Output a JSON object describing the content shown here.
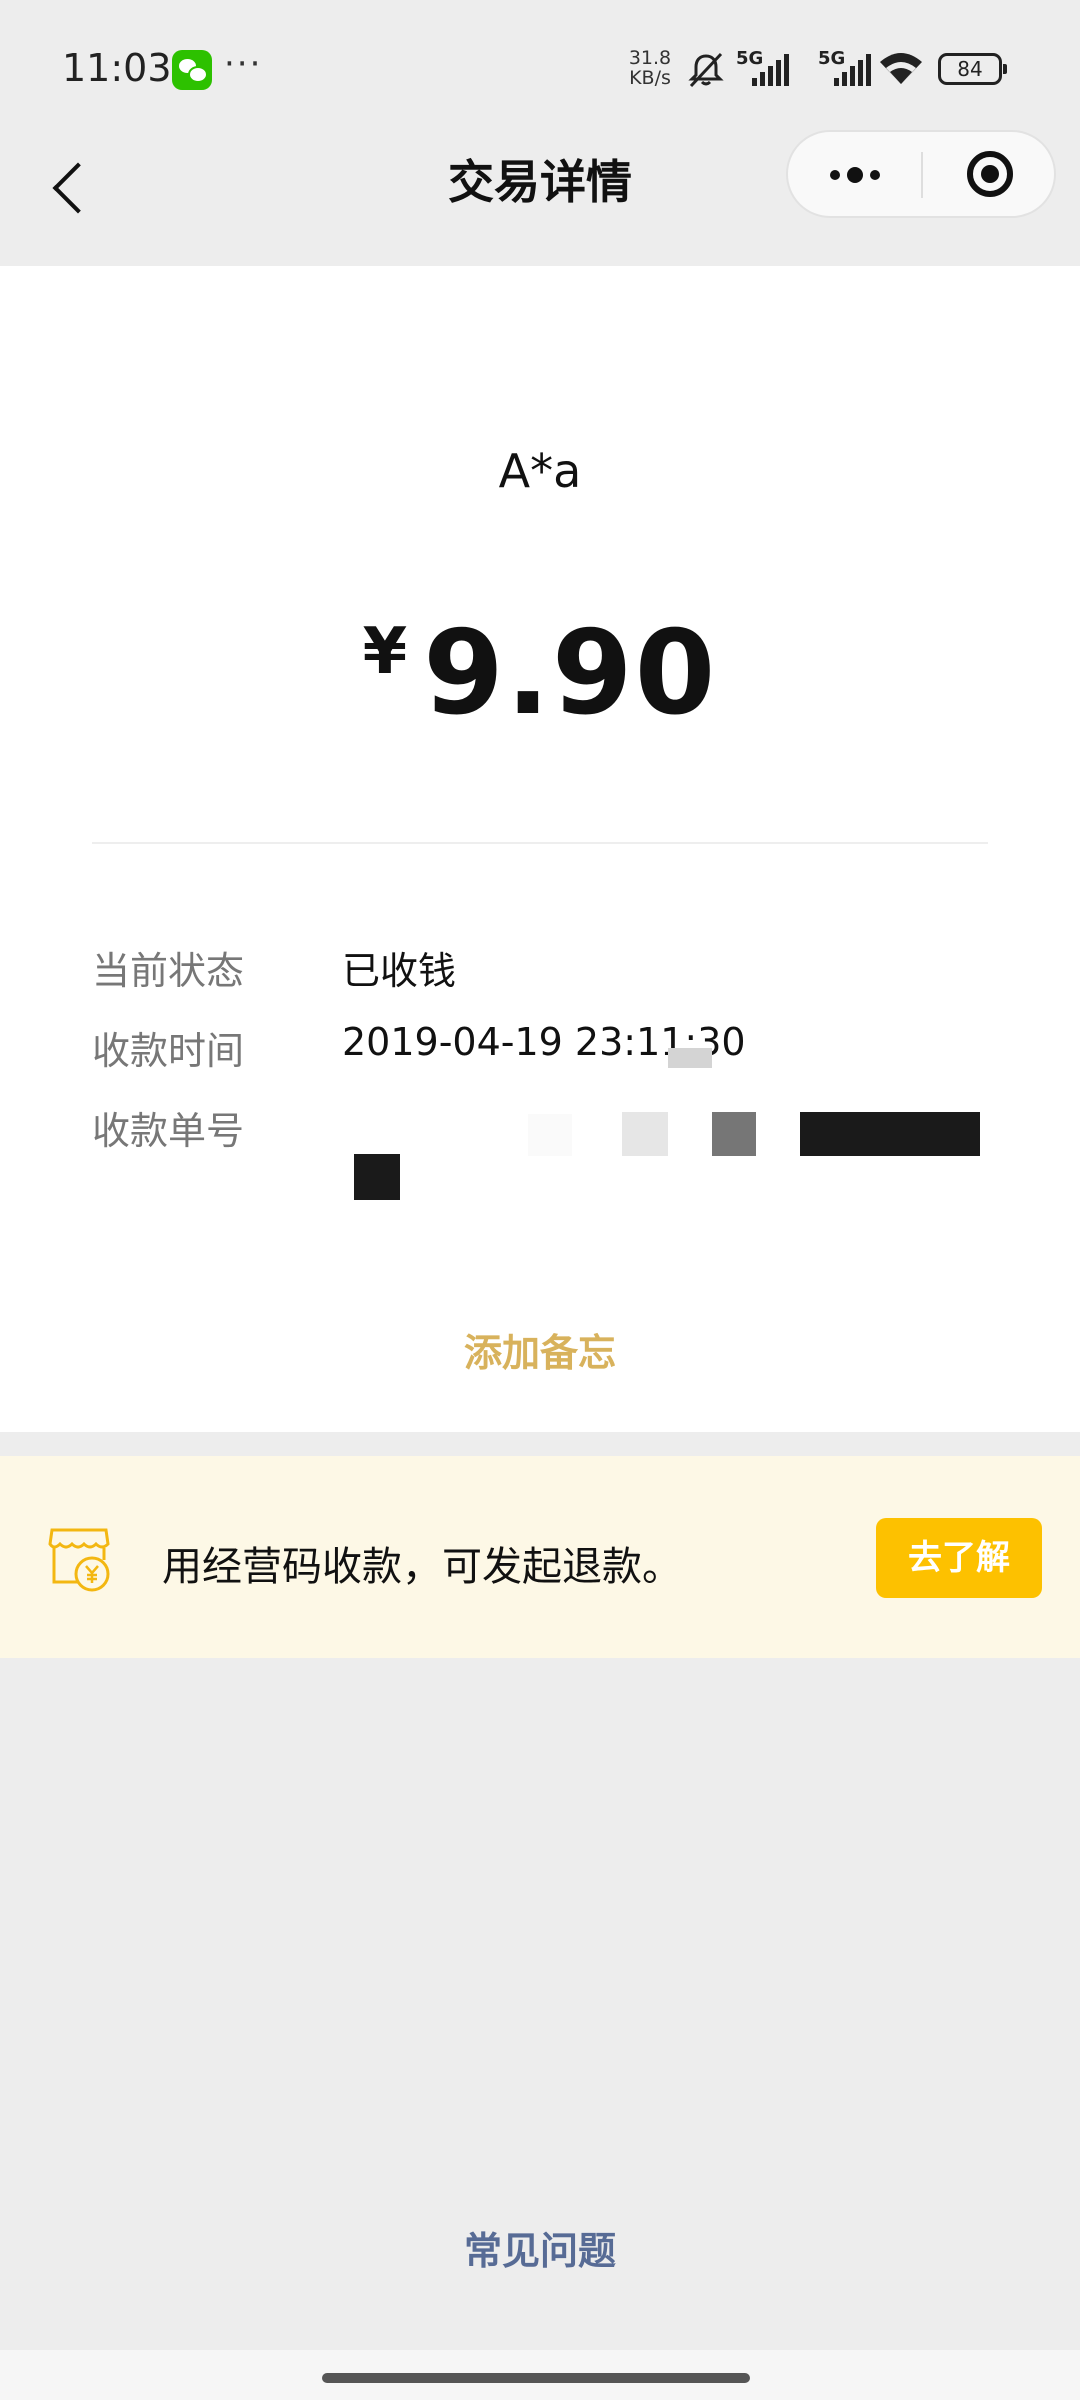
{
  "status_bar": {
    "time": "11:03",
    "more_dots": "···",
    "net_speed_value": "31.8",
    "net_speed_unit": "KB/s",
    "signal_label_1": "5G",
    "signal_label_2": "5G",
    "battery_level": "84",
    "icons": [
      "wechat-icon",
      "mute-icon",
      "signal-icon",
      "signal-icon",
      "wifi-icon",
      "battery-icon"
    ]
  },
  "nav": {
    "title": "交易详情",
    "icons": [
      "back-icon",
      "more-icon",
      "target-icon"
    ]
  },
  "transaction": {
    "payer": "A*a",
    "currency_symbol": "¥",
    "amount": "9.90",
    "rows": [
      {
        "label": "当前状态",
        "value": "已收钱"
      },
      {
        "label": "收款时间",
        "value": "2019-04-19 23:11:30"
      },
      {
        "label": "收款单号",
        "value": ""
      }
    ],
    "add_memo": "添加备忘"
  },
  "promo": {
    "text": "用经营码收款，可发起退款。",
    "button": "去了解",
    "icon": "shop-yen-icon",
    "accent_color": "#fdc100"
  },
  "footer": {
    "faq": "常见问题",
    "link_color": "#576b95"
  }
}
